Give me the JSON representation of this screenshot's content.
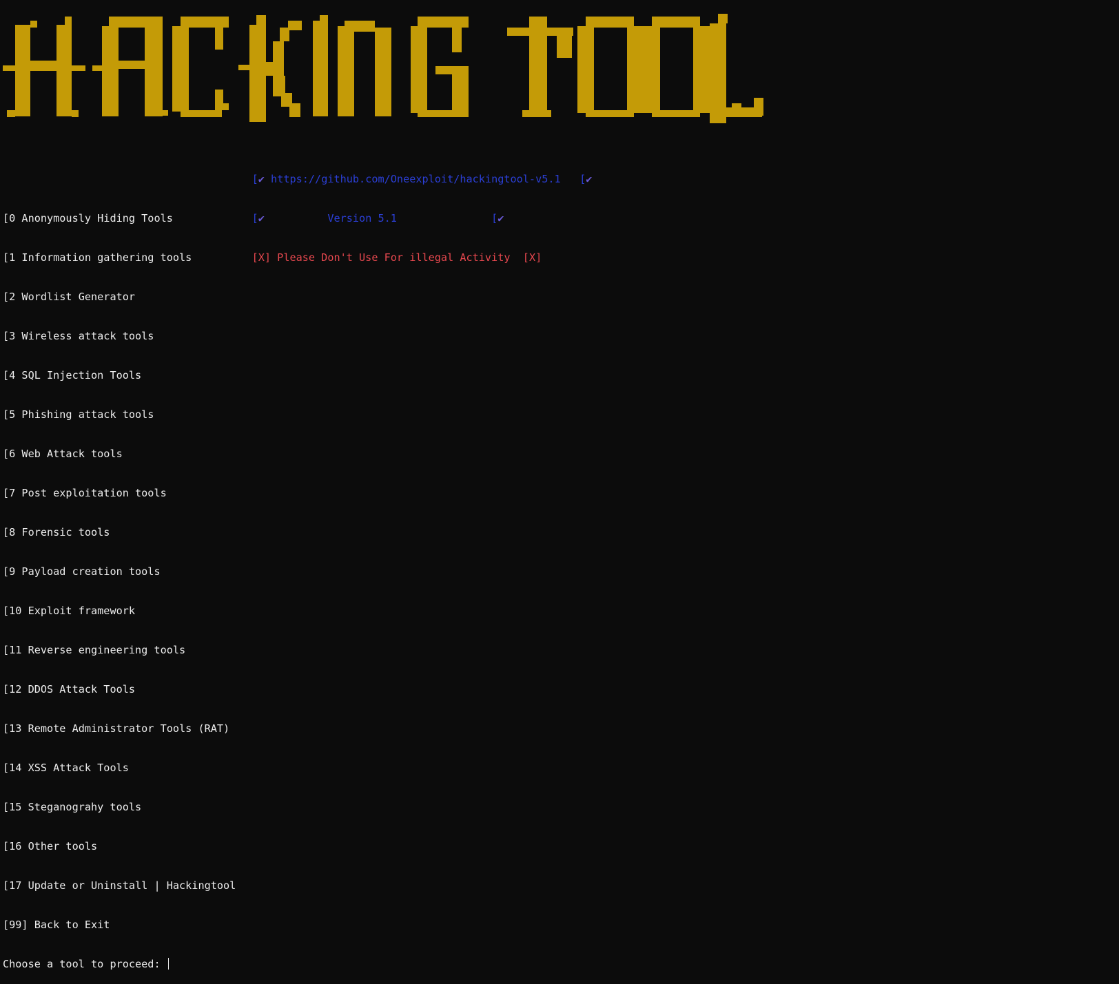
{
  "title_art": "HACKING TOOL",
  "colors": {
    "banner": "#c49b07",
    "background": "#0c0c0c",
    "link": "#2b3fd6",
    "warning": "#e8484f",
    "text": "#ececec"
  },
  "header": {
    "link_prefix": "[",
    "check_icon": "✔",
    "url": "https://github.com/Oneexploit/hackingtool-v5.1",
    "version": "Version 5.1",
    "warning_prefix": "[X]",
    "warning_text": "Please Don't Use For illegal Activity",
    "warning_suffix": "[X]"
  },
  "menu": [
    {
      "label": "[0 Anonymously Hiding Tools"
    },
    {
      "label": "[1 Information gathering tools"
    },
    {
      "label": "[2 Wordlist Generator"
    },
    {
      "label": "[3 Wireless attack tools"
    },
    {
      "label": "[4 SQL Injection Tools"
    },
    {
      "label": "[5 Phishing attack tools"
    },
    {
      "label": "[6 Web Attack tools"
    },
    {
      "label": "[7 Post exploitation tools"
    },
    {
      "label": "[8 Forensic tools"
    },
    {
      "label": "[9 Payload creation tools"
    },
    {
      "label": "[10 Exploit framework"
    },
    {
      "label": "[11 Reverse engineering tools"
    },
    {
      "label": "[12 DDOS Attack Tools"
    },
    {
      "label": "[13 Remote Administrator Tools (RAT)"
    },
    {
      "label": "[14 XSS Attack Tools"
    },
    {
      "label": "[15 Steganograhy tools"
    },
    {
      "label": "[16 Other tools"
    },
    {
      "label": "[17 Update or Uninstall | Hackingtool"
    },
    {
      "label": "[99] Back to Exit"
    }
  ],
  "prompt": "Choose a tool to proceed: "
}
